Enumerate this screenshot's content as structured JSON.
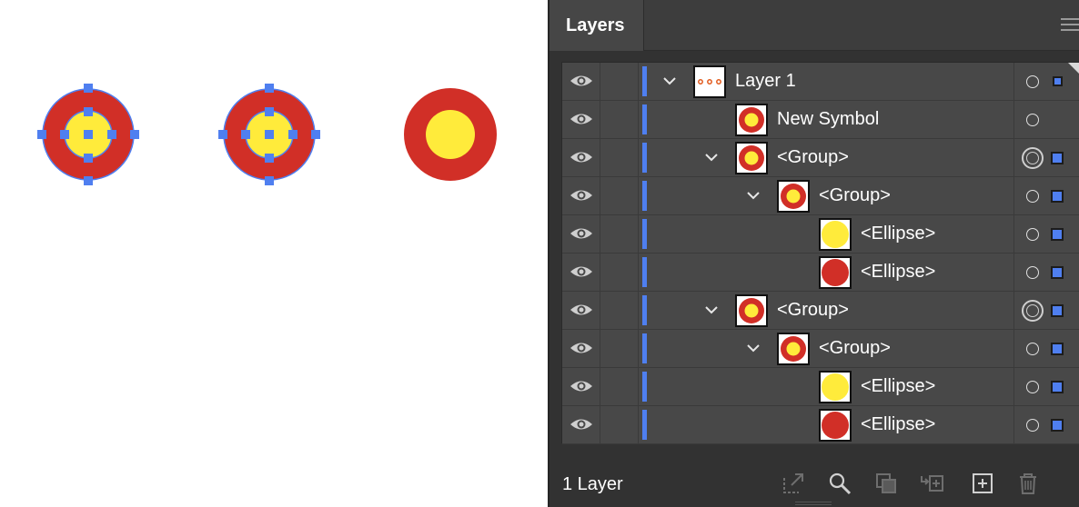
{
  "panel": {
    "tab_label": "Layers",
    "footer_label": "1 Layer"
  },
  "colors": {
    "accent": "#4f7ff0",
    "red": "#d12f27",
    "yellow": "#ffeb3b"
  },
  "layers": [
    {
      "label": "Layer 1",
      "icon": "layer-thumbnail",
      "expanded": true
    },
    {
      "label": "New Symbol",
      "icon": "symbol-thumbnail"
    },
    {
      "label": "<Group>",
      "icon": "group-thumbnail",
      "expanded": true
    },
    {
      "label": "<Group>",
      "icon": "group-thumbnail",
      "expanded": true
    },
    {
      "label": "<Ellipse>",
      "icon": "yellow-ellipse-thumbnail"
    },
    {
      "label": "<Ellipse>",
      "icon": "red-ellipse-thumbnail"
    },
    {
      "label": "<Group>",
      "icon": "group-thumbnail",
      "expanded": true
    },
    {
      "label": "<Group>",
      "icon": "group-thumbnail",
      "expanded": true
    },
    {
      "label": "<Ellipse>",
      "icon": "yellow-ellipse-thumbnail"
    },
    {
      "label": "<Ellipse>",
      "icon": "red-ellipse-thumbnail"
    }
  ],
  "footer_icons": [
    "export-icon",
    "search-icon",
    "clipping-mask-icon",
    "move-to-layer-icon",
    "new-layer-icon",
    "trash-icon"
  ]
}
